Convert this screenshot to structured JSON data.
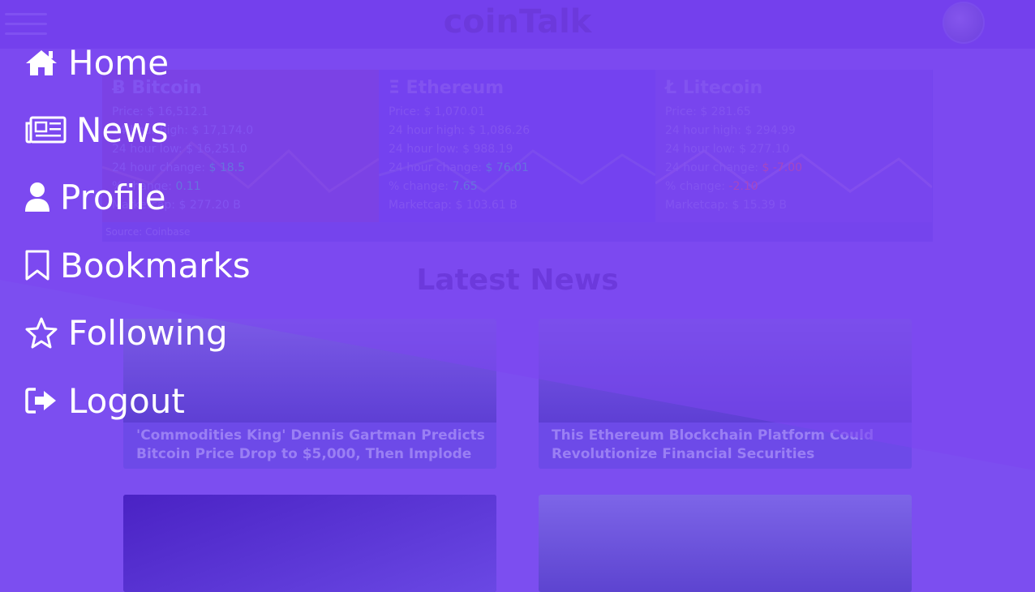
{
  "header": {
    "brand": "coinTalk"
  },
  "ticker": {
    "coins": [
      {
        "name": "Ƀ Bitcoin",
        "price": "Price: $ 16,512.1",
        "high": "24 hour high: $ 17,174.0",
        "low": "24 hour low: $ 16,251.0",
        "change_label": "24 hour change:",
        "change_value": "$ 18.5",
        "change_dir": "pos",
        "pct_label": "% change:",
        "pct_value": "0.11",
        "marketcap": "Marketcap: $ 277.20 B"
      },
      {
        "name": "Ξ Ethereum",
        "price": "Price: $ 1,070.01",
        "high": "24 hour high: $ 1,086.26",
        "low": "24 hour low: $ 988.19",
        "change_label": "24 hour change:",
        "change_value": "$ 76.01",
        "change_dir": "pos",
        "pct_label": "% change:",
        "pct_value": "7.65",
        "marketcap": "Marketcap: $ 103.61 B"
      },
      {
        "name": "Ł Litecoin",
        "price": "Price: $ 281.65",
        "high": "24 hour high: $ 294.99",
        "low": "24 hour low: $ 277.10",
        "change_label": "24 hour change:",
        "change_value": "$ -7.00",
        "change_dir": "neg",
        "pct_label": "% change:",
        "pct_value": "-2.10",
        "marketcap": "Marketcap: $ 15.39 B"
      }
    ],
    "source": "Source: Coinbase"
  },
  "news": {
    "heading": "Latest News",
    "cards": [
      {
        "title": "'Commodities King' Dennis Gartman Predicts Bitcoin Price Drop to $5,000, Then Implode"
      },
      {
        "title": "This Ethereum Blockchain Platform Could Revolutionize Financial Securities"
      }
    ]
  },
  "menu": {
    "items": [
      {
        "label": "Home",
        "icon": "home-icon"
      },
      {
        "label": "News",
        "icon": "newspaper-icon"
      },
      {
        "label": "Profile",
        "icon": "user-icon"
      },
      {
        "label": "Bookmarks",
        "icon": "bookmark-icon"
      },
      {
        "label": "Following",
        "icon": "star-icon"
      },
      {
        "label": "Logout",
        "icon": "logout-icon"
      }
    ]
  },
  "colors": {
    "menu_overlay": "#7b45f0",
    "page_background": "#7c4ef0",
    "positive": "#4fa7c8",
    "negative": "#d64a8a"
  }
}
